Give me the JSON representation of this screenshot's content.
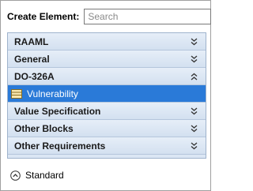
{
  "search": {
    "label": "Create Element:",
    "placeholder": "Search",
    "value": ""
  },
  "palette": {
    "groups": [
      {
        "label": "RAAML",
        "state": "collapsed"
      },
      {
        "label": "General",
        "state": "collapsed"
      },
      {
        "label": "DO-326A",
        "state": "expanded"
      },
      {
        "label": "Value Specification",
        "state": "collapsed"
      },
      {
        "label": "Other Blocks",
        "state": "collapsed"
      },
      {
        "label": "Other Requirements",
        "state": "collapsed"
      }
    ],
    "selected_item": {
      "label": "Vulnerability",
      "icon": "vulnerability-block-icon"
    }
  },
  "footer": {
    "standard_label": "Standard"
  },
  "colors": {
    "group_bg": "#dbe6f4",
    "selection": "#2a7ad8"
  }
}
